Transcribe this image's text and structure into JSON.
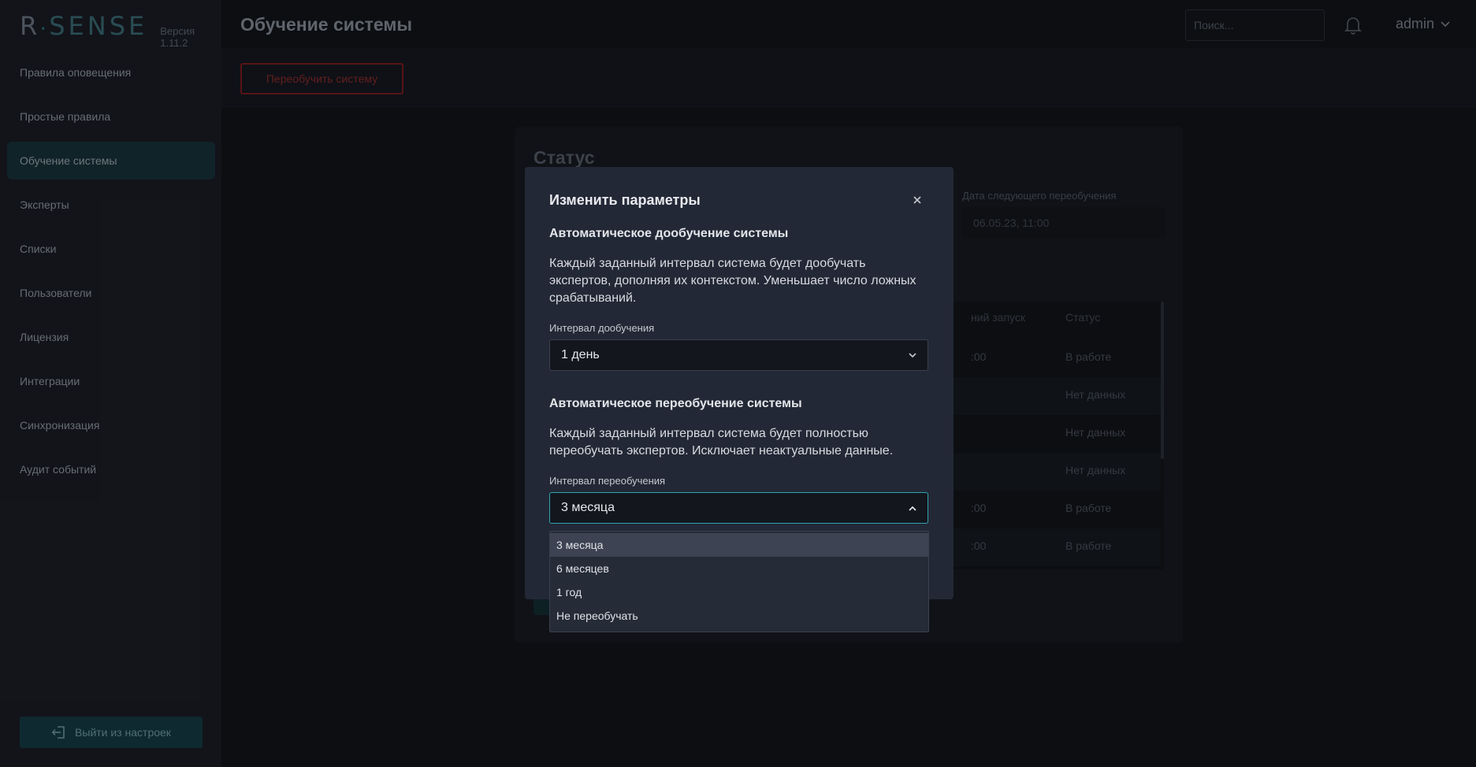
{
  "brand": {
    "logo_r": "R",
    "logo_dot": "·",
    "logo_rest": "SENSE",
    "version": "Версия 1.11.2"
  },
  "sidebar": {
    "items": [
      {
        "label": "Правила оповещения",
        "active": false
      },
      {
        "label": "Простые правила",
        "active": false
      },
      {
        "label": "Обучение системы",
        "active": true
      },
      {
        "label": "Эксперты",
        "active": false
      },
      {
        "label": "Списки",
        "active": false
      },
      {
        "label": "Пользователи",
        "active": false
      },
      {
        "label": "Лицензия",
        "active": false
      },
      {
        "label": "Интеграции",
        "active": false
      },
      {
        "label": "Синхронизация",
        "active": false
      },
      {
        "label": "Аудит событий",
        "active": false
      }
    ],
    "exit_label": "Выйти из настроек"
  },
  "header": {
    "title": "Обучение системы",
    "search_placeholder": "Поиск...",
    "user": "admin"
  },
  "toolbar": {
    "retrain_label": "Переобучить систему"
  },
  "status_card": {
    "title": "Статус",
    "next_retrain_label": "Дата следующего переобучения",
    "next_retrain_value": "06.05.23, 11:00",
    "table": {
      "headers": [
        "ний запуск",
        "Статус"
      ],
      "rows": [
        {
          "last": ":00",
          "status": "В работе"
        },
        {
          "last": "",
          "status": "Нет данных"
        },
        {
          "last": "",
          "status": "Нет данных"
        },
        {
          "last": "",
          "status": "Нет данных"
        },
        {
          "last": ":00",
          "status": "В работе"
        },
        {
          "last": ":00",
          "status": "В работе"
        }
      ]
    }
  },
  "modal": {
    "title": "Изменить параметры",
    "section1": {
      "title": "Автоматическое дообучение системы",
      "text": "Каждый заданный интервал система будет дообучать экспертов, дополняя их контекстом. Уменьшает число ложных срабатываний.",
      "field_label": "Интервал дообучения",
      "value": "1 день"
    },
    "section2": {
      "title": "Автоматическое переобучение системы",
      "text": "Каждый заданный интервал система будет полностью переобучать экспертов. Исключает неактуальные данные.",
      "field_label": "Интервал переобучения",
      "value": "3 месяца"
    },
    "dropdown_options": [
      "3 месяца",
      "6 месяцев",
      "1 год",
      "Не переобучать"
    ]
  },
  "colors": {
    "accent": "#2ea3b0",
    "danger": "#7a1d1d",
    "modal_bg": "#232836"
  }
}
